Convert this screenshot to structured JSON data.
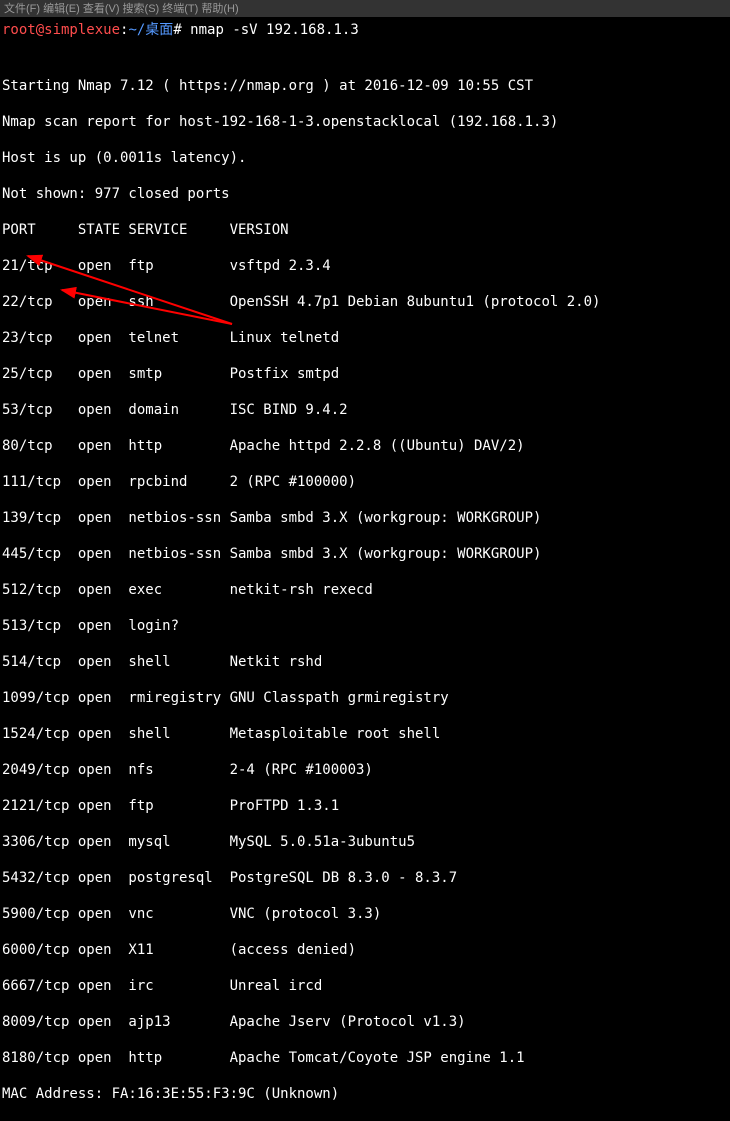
{
  "menubar": "文件(F)  编辑(E)  查看(V)  搜索(S)  终端(T)  帮助(H)",
  "prompt": {
    "user_host": "root@simplexue",
    "sep1": ":",
    "cwd": "~/桌面",
    "sep2": "# ",
    "command": "nmap -sV 192.168.1.3"
  },
  "lines": {
    "blank": "",
    "start": "Starting Nmap 7.12 ( https://nmap.org ) at 2016-12-09 10:55 CST",
    "report": "Nmap scan report for host-192-168-1-3.openstacklocal (192.168.1.3)",
    "host_up": "Host is up (0.0011s latency).",
    "not_shown": "Not shown: 977 closed ports",
    "header": "PORT     STATE SERVICE     VERSION",
    "r01": "21/tcp   open  ftp         vsftpd 2.3.4",
    "r02": "22/tcp   open  ssh         OpenSSH 4.7p1 Debian 8ubuntu1 (protocol 2.0)",
    "r03": "23/tcp   open  telnet      Linux telnetd",
    "r04": "25/tcp   open  smtp        Postfix smtpd",
    "r05": "53/tcp   open  domain      ISC BIND 9.4.2",
    "r06": "80/tcp   open  http        Apache httpd 2.2.8 ((Ubuntu) DAV/2)",
    "r07": "111/tcp  open  rpcbind     2 (RPC #100000)",
    "r08": "139/tcp  open  netbios-ssn Samba smbd 3.X (workgroup: WORKGROUP)",
    "r09": "445/tcp  open  netbios-ssn Samba smbd 3.X (workgroup: WORKGROUP)",
    "r10": "512/tcp  open  exec        netkit-rsh rexecd",
    "r11": "513/tcp  open  login?",
    "r12": "514/tcp  open  shell       Netkit rshd",
    "r13": "1099/tcp open  rmiregistry GNU Classpath grmiregistry",
    "r14": "1524/tcp open  shell       Metasploitable root shell",
    "r15": "2049/tcp open  nfs         2-4 (RPC #100003)",
    "r16": "2121/tcp open  ftp         ProFTPD 1.3.1",
    "r17": "3306/tcp open  mysql       MySQL 5.0.51a-3ubuntu5",
    "r18": "5432/tcp open  postgresql  PostgreSQL DB 8.3.0 - 8.3.7",
    "r19": "5900/tcp open  vnc         VNC (protocol 3.3)",
    "r20": "6000/tcp open  X11         (access denied)",
    "r21": "6667/tcp open  irc         Unreal ircd",
    "r22": "8009/tcp open  ajp13       Apache Jserv (Protocol v1.3)",
    "r23": "8180/tcp open  http        Apache Tomcat/Coyote JSP engine 1.1",
    "mac": "MAC Address: FA:16:3E:55:F3:9C (Unknown)"
  },
  "annotation": {
    "color": "#ff0000"
  }
}
